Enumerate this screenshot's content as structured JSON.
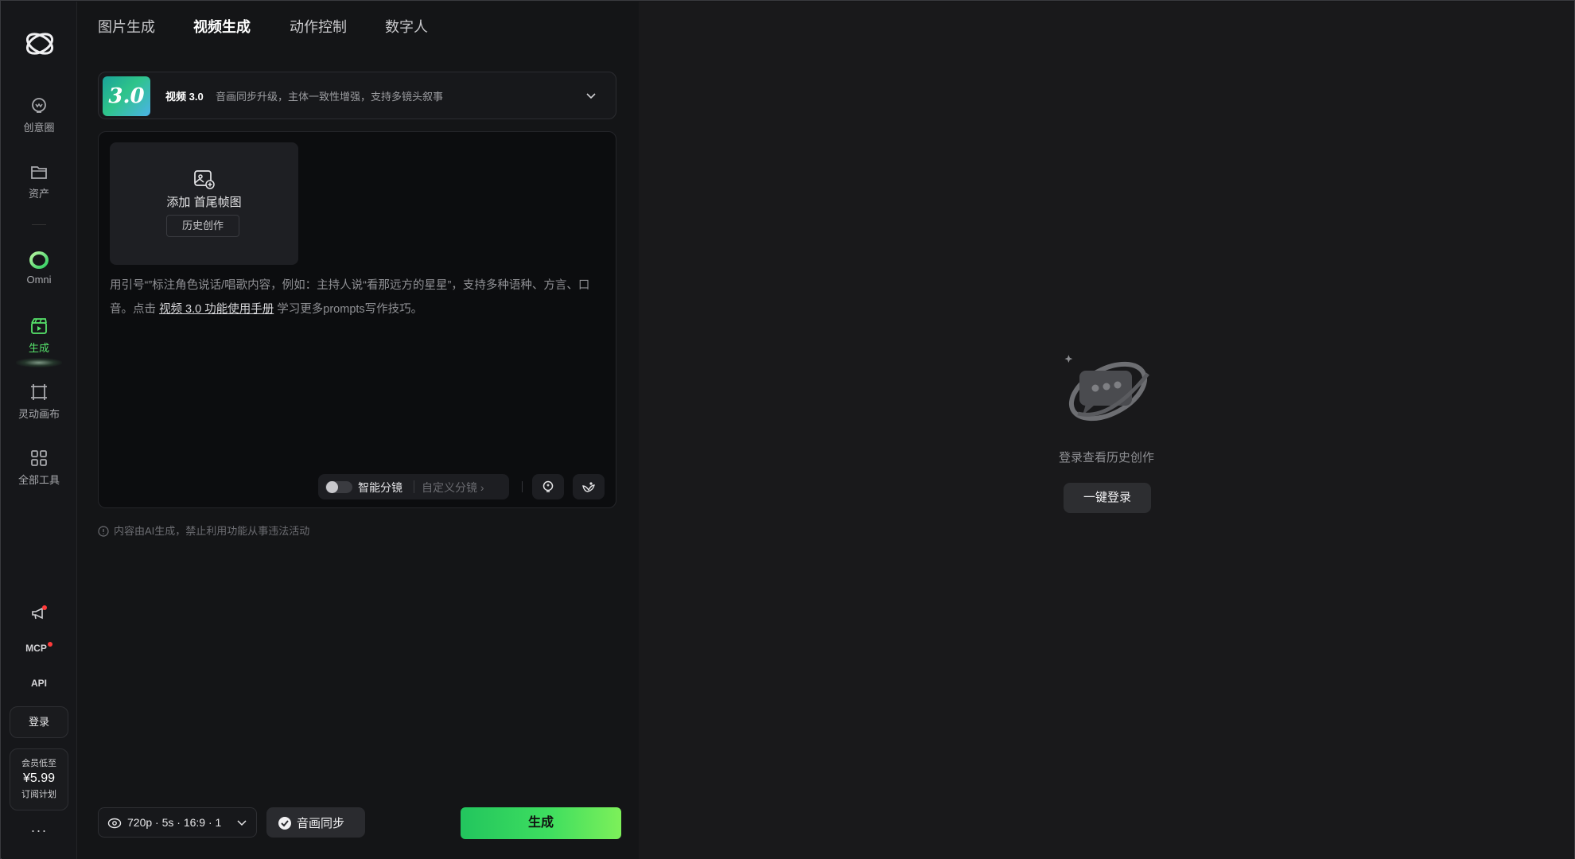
{
  "sidebar": {
    "items": [
      {
        "label": "创意圈",
        "icon": "idea-bulb-icon"
      },
      {
        "label": "资产",
        "icon": "folder-icon"
      },
      {
        "label": "Omni",
        "icon": "omni-ring-icon"
      },
      {
        "label": "生成",
        "icon": "generate-clapper-icon"
      },
      {
        "label": "灵动画布",
        "icon": "canvas-frame-icon"
      },
      {
        "label": "全部工具",
        "icon": "grid-icon"
      }
    ],
    "mcp_label": "MCP",
    "api_label": "API",
    "login_label": "登录",
    "vip": {
      "line1": "会员低至",
      "price": "¥5.99",
      "line2": "订阅计划"
    },
    "more_label": "···"
  },
  "tabs": [
    {
      "label": "图片生成",
      "active": false
    },
    {
      "label": "视频生成",
      "active": true
    },
    {
      "label": "动作控制",
      "active": false
    },
    {
      "label": "数字人",
      "active": false
    }
  ],
  "model": {
    "badge": "3.0",
    "name": "视频 3.0",
    "description": "音画同步升级，主体一致性增强，支持多镜头叙事"
  },
  "upload": {
    "title": "添加 首尾帧图",
    "history_label": "历史创作"
  },
  "hint": {
    "part1": "用引号“”标注角色说话/唱歌内容，例如：主持人说“看那远方的星星”，支持多种语种、方言、口音。点击 ",
    "link": "视频 3.0 功能使用手册",
    "part2": " 学习更多prompts写作技巧。"
  },
  "tools": {
    "smart_label": "智能分镜",
    "custom_label": "自定义分镜 ›"
  },
  "notice": "内容由AI生成，禁止利用功能从事违法活动",
  "bottom": {
    "options": "720p · 5s · 16:9 · 1",
    "sync_label": "音画同步",
    "generate_label": "生成"
  },
  "right_panel": {
    "empty_text": "登录查看历史创作",
    "login_label": "一键登录"
  },
  "colors": {
    "accent": "#3ede5f",
    "background": "#151618"
  }
}
